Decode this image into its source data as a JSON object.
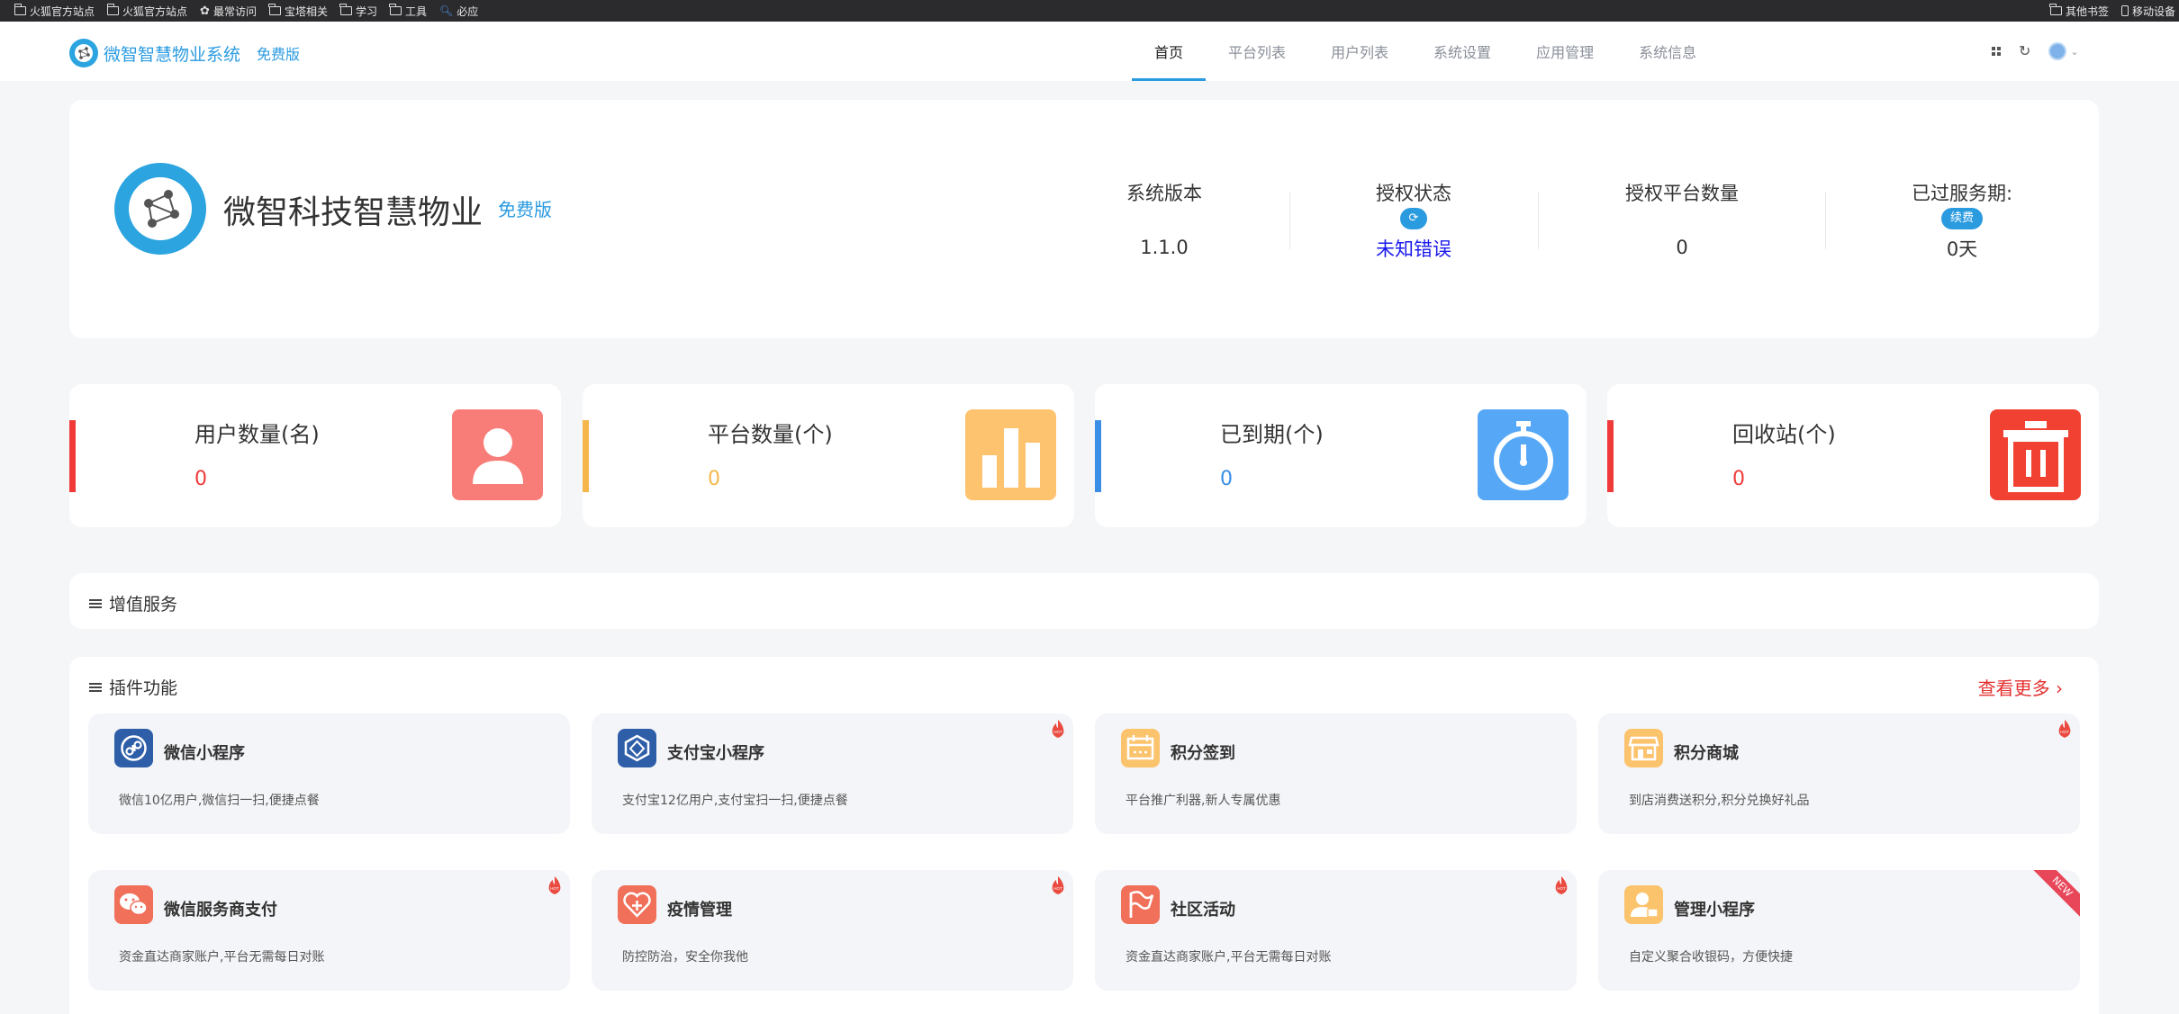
{
  "bookmarks": {
    "items": [
      "火狐官方站点",
      "火狐官方站点",
      "最常访问",
      "宝塔相关",
      "学习",
      "工具",
      "必应"
    ],
    "right": [
      "其他书签",
      "移动设备"
    ]
  },
  "nav": {
    "brand": "微智智慧物业系统",
    "edition": "免费版",
    "tabs": [
      "首页",
      "平台列表",
      "用户列表",
      "系统设置",
      "应用管理",
      "系统信息"
    ],
    "active_tab": "首页"
  },
  "info": {
    "company": "微智科技智慧物业",
    "edition": "免费版",
    "version_label": "系统版本",
    "version_value": "1.1.0",
    "license_label": "授权状态",
    "license_value": "未知错误",
    "platform_label": "授权平台数量",
    "platform_value": "0",
    "service_label": "已过服务期:",
    "renew_label": "续费",
    "service_value": "0天"
  },
  "metrics": [
    {
      "label": "用户数量(名)",
      "value": "0",
      "color": "#f03a3a",
      "icon": "user-icon",
      "icon_bg": "#f87d78"
    },
    {
      "label": "平台数量(个)",
      "value": "0",
      "color": "#f5b74b",
      "icon": "bar-chart-icon",
      "icon_bg": "#fec36f"
    },
    {
      "label": "已到期(个)",
      "value": "0",
      "color": "#3a8ee6",
      "icon": "stopwatch-icon",
      "icon_bg": "#56a8f7"
    },
    {
      "label": "回收站(个)",
      "value": "0",
      "color": "#f03a3a",
      "icon": "trash-icon",
      "icon_bg": "#f04132"
    }
  ],
  "value_added": {
    "title": "增值服务"
  },
  "plugins": {
    "title": "插件功能",
    "more": "查看更多",
    "items": [
      {
        "title": "微信小程序",
        "desc": "微信10亿用户,微信扫一扫,便捷点餐",
        "icon": "wechat-miniprogram-icon",
        "color": "#2f5ea8",
        "badge": ""
      },
      {
        "title": "支付宝小程序",
        "desc": "支付宝12亿用户,支付宝扫一扫,便捷点餐",
        "icon": "alipay-miniprogram-icon",
        "color": "#2f5ea8",
        "badge": "hot"
      },
      {
        "title": "积分签到",
        "desc": "平台推广利器,新人专属优惠",
        "icon": "calendar-icon",
        "color": "#fcc36d",
        "badge": ""
      },
      {
        "title": "积分商城",
        "desc": "到店消费送积分,积分兑换好礼品",
        "icon": "shop-icon",
        "color": "#fcc36d",
        "badge": "hot"
      },
      {
        "title": "微信服务商支付",
        "desc": "资金直达商家账户,平台无需每日对账",
        "icon": "wechat-pay-icon",
        "color": "#f0705a",
        "badge": "hot"
      },
      {
        "title": "疫情管理",
        "desc": "防控防治，安全你我他",
        "icon": "heart-icon",
        "color": "#f0705a",
        "badge": "hot"
      },
      {
        "title": "社区活动",
        "desc": "资金直达商家账户,平台无需每日对账",
        "icon": "flag-icon",
        "color": "#f0705a",
        "badge": "hot"
      },
      {
        "title": "管理小程序",
        "desc": "自定义聚合收银码，方便快捷",
        "icon": "admin-icon",
        "color": "#fcc36d",
        "badge": "new"
      }
    ],
    "new_label": "NEW"
  }
}
